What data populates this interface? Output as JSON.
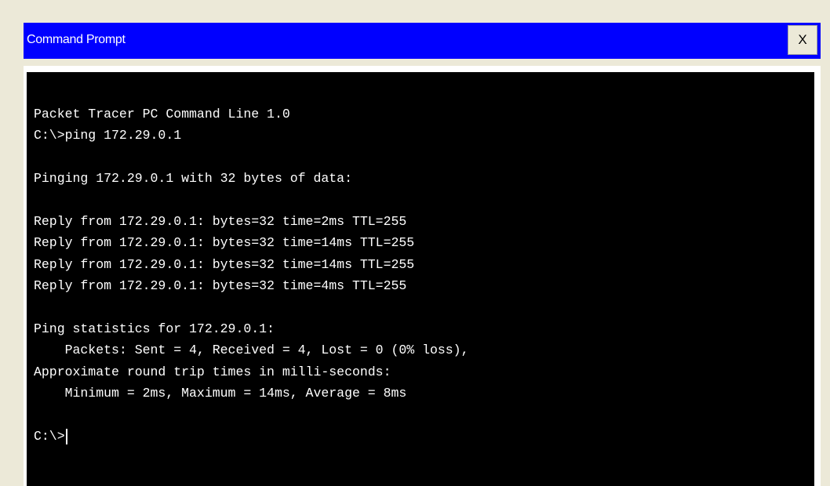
{
  "window": {
    "title": "Command Prompt",
    "close_label": "X"
  },
  "console": {
    "lines": [
      "Packet Tracer PC Command Line 1.0",
      "C:\\>ping 172.29.0.1",
      "",
      "Pinging 172.29.0.1 with 32 bytes of data:",
      "",
      "Reply from 172.29.0.1: bytes=32 time=2ms TTL=255",
      "Reply from 172.29.0.1: bytes=32 time=14ms TTL=255",
      "Reply from 172.29.0.1: bytes=32 time=14ms TTL=255",
      "Reply from 172.29.0.1: bytes=32 time=4ms TTL=255",
      "",
      "Ping statistics for 172.29.0.1:",
      "    Packets: Sent = 4, Received = 4, Lost = 0 (0% loss),",
      "Approximate round trip times in milli-seconds:",
      "    Minimum = 2ms, Maximum = 14ms, Average = 8ms",
      ""
    ],
    "prompt": "C:\\>"
  },
  "colors": {
    "titlebar": "#0000ff",
    "console_bg": "#000000",
    "console_text": "#ffffff",
    "chrome": "#ece9d8"
  }
}
